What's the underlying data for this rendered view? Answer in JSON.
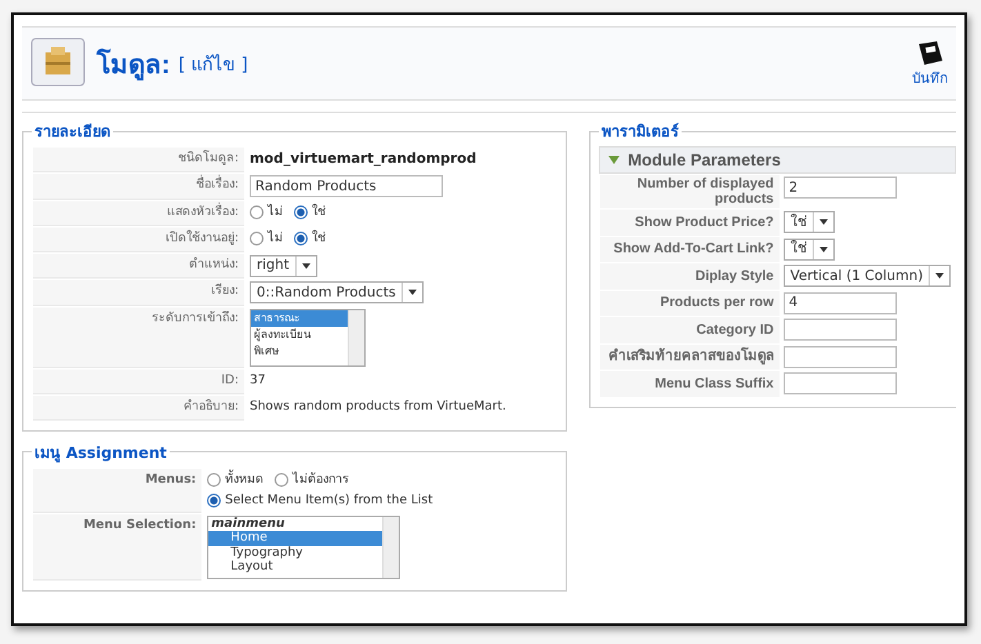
{
  "header": {
    "title": "โมดูล:",
    "subtitle": "[ แก้ไข ]",
    "save_label": "บันทึก"
  },
  "details": {
    "legend": "รายละเอียด",
    "rows": [
      {
        "kind": "text",
        "label": "ชนิดโมดูล:",
        "value": "mod_virtuemart_randomprod",
        "bold": true
      },
      {
        "kind": "input",
        "label": "ชื่อเรื่อง:",
        "value": "Random Products"
      },
      {
        "kind": "radio",
        "label": "แสดงหัวเรื่อง:",
        "options": [
          {
            "label": "ไม่",
            "selected": false
          },
          {
            "label": "ใช่",
            "selected": true
          }
        ]
      },
      {
        "kind": "radio",
        "label": "เปิดใช้งานอยู่:",
        "options": [
          {
            "label": "ไม่",
            "selected": false
          },
          {
            "label": "ใช่",
            "selected": true
          }
        ]
      },
      {
        "kind": "select",
        "label": "ตำแหน่ง:",
        "value": "right"
      },
      {
        "kind": "select",
        "label": "เรียง:",
        "value": "0::Random Products"
      },
      {
        "kind": "listbox",
        "label": "ระดับการเข้าถึง:",
        "items": [
          {
            "label": "สาธารณะ",
            "selected": true
          },
          {
            "label": "ผู้ลงทะเบียน",
            "selected": false
          },
          {
            "label": "พิเศษ",
            "selected": false
          }
        ]
      },
      {
        "kind": "text",
        "label": "ID:",
        "value": "37",
        "bold": false
      },
      {
        "kind": "text",
        "label": "คำอธิบาย:",
        "value": "Shows random products from VirtueMart.",
        "bold": false
      }
    ]
  },
  "parameters": {
    "legend": "พารามิเตอร์",
    "panel_title": "Module Parameters",
    "expanded": true,
    "rows": [
      {
        "kind": "input",
        "label": "Number of displayed products",
        "value": "2"
      },
      {
        "kind": "select",
        "label": "Show Product Price?",
        "value": "ใช่"
      },
      {
        "kind": "select",
        "label": "Show Add-To-Cart Link?",
        "value": "ใช่"
      },
      {
        "kind": "select",
        "label": "Diplay Style",
        "value": "Vertical (1 Column)"
      },
      {
        "kind": "input",
        "label": "Products per row",
        "value": "4"
      },
      {
        "kind": "input",
        "label": "Category ID"
      },
      {
        "kind": "input",
        "label": "คำเสริมท้ายคลาสของโมดูล"
      },
      {
        "kind": "input",
        "label": "Menu Class Suffix"
      }
    ]
  },
  "menu_assignment": {
    "legend": "เมนู Assignment",
    "rows": [
      {
        "kind": "radio",
        "label": "Menus:",
        "options": [
          {
            "label": "ทั้งหมด",
            "selected": false
          },
          {
            "label": "ไม่ต้องการ",
            "selected": false
          },
          {
            "label": "Select Menu Item(s) from the List",
            "selected": true
          }
        ]
      },
      {
        "kind": "listbox",
        "label": "Menu Selection:",
        "items": [
          {
            "label": "mainmenu",
            "kind": "group",
            "selected": false
          },
          {
            "label": "Home",
            "kind": "item",
            "selected": true
          },
          {
            "label": "Typography",
            "kind": "item",
            "selected": false
          },
          {
            "label": "Layout",
            "kind": "item",
            "selected": false
          }
        ]
      }
    ]
  }
}
